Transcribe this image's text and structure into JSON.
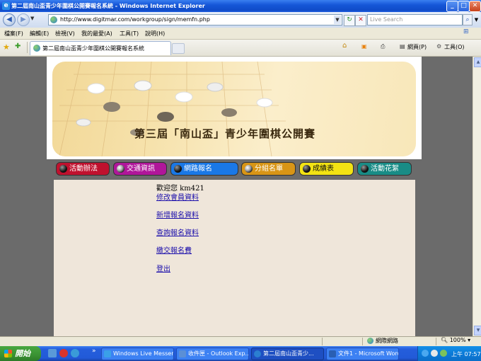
{
  "window": {
    "title": "第二屆南山盃青少年圍棋公開賽報名系統 - Windows Internet Explorer",
    "min": "_",
    "max": "□",
    "close": "✕"
  },
  "address": {
    "url": "http://www.digitmar.com/workgroup/sign/memfn.php",
    "search_placeholder": "Live Search"
  },
  "menu": [
    "檔案(F)",
    "編輯(E)",
    "檢視(V)",
    "我的最愛(A)",
    "工具(T)",
    "說明(H)"
  ],
  "tab": {
    "label": "第二屆南山盃青少年圍棋公開賽報名系統"
  },
  "commandbar": {
    "page": "網頁(P)",
    "tools": "工具(O)"
  },
  "banner": {
    "title": "第三屆「南山盃」青少年圍棋公開賽"
  },
  "nav": [
    {
      "label": "活動辦法",
      "color": "#c0112e",
      "dark": true
    },
    {
      "label": "交通資訊",
      "color": "#b0169a",
      "dark": false
    },
    {
      "label": "網路報名",
      "color": "#1a78e6",
      "dark": true
    },
    {
      "label": "分組名單",
      "color": "#d89516",
      "dark": false
    },
    {
      "label": "成績表",
      "color": "#f3e313",
      "dark": true
    },
    {
      "label": "活動花絮",
      "color": "#198c86",
      "dark": true
    }
  ],
  "content": {
    "welcome": "歡迎您 km421",
    "links": [
      "修改會員資料",
      "新增報名資料",
      "查詢報名資料",
      "繳交報名費",
      "登出"
    ]
  },
  "status": {
    "zone": "網際網路",
    "zoom": "100%"
  },
  "taskbar": {
    "start": "開始",
    "tasks": [
      {
        "label": "Windows Live Messen...",
        "color": "#3aa0e8"
      },
      {
        "label": "收件匣 - Outlook Exp...",
        "color": "#5b8fd6"
      },
      {
        "label": "第二屆南山盃青少...",
        "color": "#2b7fd1"
      },
      {
        "label": "文件1 - Microsoft Word",
        "color": "#2a5fb3"
      }
    ],
    "clock": "上午 07:57"
  }
}
